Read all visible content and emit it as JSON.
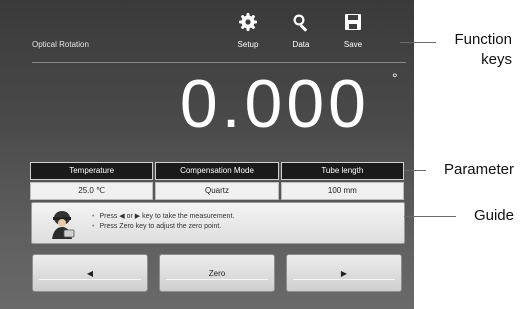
{
  "header": {
    "title": "Optical Rotation",
    "function_keys": [
      {
        "label": "Setup",
        "icon": "gear-icon"
      },
      {
        "label": "Data",
        "icon": "magnifier-icon"
      },
      {
        "label": "Save",
        "icon": "save-icon"
      }
    ]
  },
  "measurement": {
    "value": "0.000",
    "unit": "°"
  },
  "parameters": {
    "headers": [
      "Temperature",
      "Compensation Mode",
      "Tube length"
    ],
    "values": [
      "25.0 ℃",
      "Quartz",
      "100 mm"
    ]
  },
  "guide": {
    "icon": "operator-icon",
    "lines": [
      "Press ◀ or ▶ key to take the measurement.",
      "Press Zero key to adjust the zero point."
    ]
  },
  "buttons": {
    "left": "◀",
    "zero": "Zero",
    "right": "▶"
  },
  "annotations": {
    "function_keys": "Function\nkeys",
    "parameter": "Parameter",
    "guide": "Guide"
  },
  "colors": {
    "screen_top": "#3a3a3a",
    "screen_bottom": "#6a6a6a",
    "header_cell": "#1a1a1a"
  }
}
